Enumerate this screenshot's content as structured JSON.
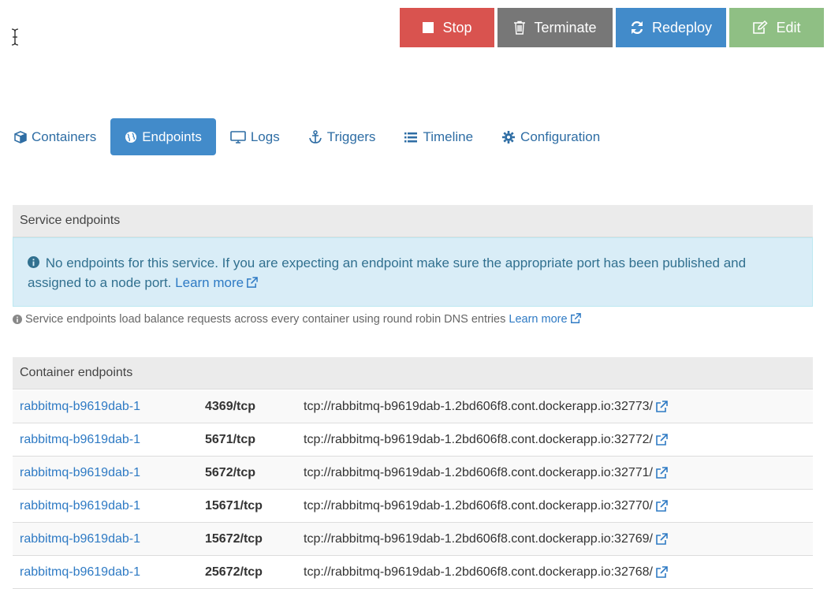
{
  "toolbar": {
    "stop_label": "Stop",
    "terminate_label": "Terminate",
    "redeploy_label": "Redeploy",
    "edit_label": "Edit"
  },
  "tabs": [
    {
      "label": "Containers",
      "icon": "cube-icon",
      "active": false
    },
    {
      "label": "Endpoints",
      "icon": "globe-icon",
      "active": true
    },
    {
      "label": "Logs",
      "icon": "desktop-icon",
      "active": false
    },
    {
      "label": "Triggers",
      "icon": "anchor-icon",
      "active": false
    },
    {
      "label": "Timeline",
      "icon": "list-icon",
      "active": false
    },
    {
      "label": "Configuration",
      "icon": "gear-icon",
      "active": false
    }
  ],
  "service_endpoints": {
    "title": "Service endpoints",
    "alert_text": "No endpoints for this service. If you are expecting an endpoint make sure the appropriate port has been published and assigned to a node port.",
    "alert_link": "Learn more",
    "help_text": "Service endpoints load balance requests across every container using round robin DNS entries",
    "help_link": "Learn more"
  },
  "container_endpoints": {
    "title": "Container endpoints",
    "rows": [
      {
        "container": "rabbitmq-b9619dab-1",
        "port": "4369/tcp",
        "url": "tcp://rabbitmq-b9619dab-1.2bd606f8.cont.dockerapp.io:32773/"
      },
      {
        "container": "rabbitmq-b9619dab-1",
        "port": "5671/tcp",
        "url": "tcp://rabbitmq-b9619dab-1.2bd606f8.cont.dockerapp.io:32772/"
      },
      {
        "container": "rabbitmq-b9619dab-1",
        "port": "5672/tcp",
        "url": "tcp://rabbitmq-b9619dab-1.2bd606f8.cont.dockerapp.io:32771/"
      },
      {
        "container": "rabbitmq-b9619dab-1",
        "port": "15671/tcp",
        "url": "tcp://rabbitmq-b9619dab-1.2bd606f8.cont.dockerapp.io:32770/"
      },
      {
        "container": "rabbitmq-b9619dab-1",
        "port": "15672/tcp",
        "url": "tcp://rabbitmq-b9619dab-1.2bd606f8.cont.dockerapp.io:32769/"
      },
      {
        "container": "rabbitmq-b9619dab-1",
        "port": "25672/tcp",
        "url": "tcp://rabbitmq-b9619dab-1.2bd606f8.cont.dockerapp.io:32768/"
      }
    ]
  },
  "colors": {
    "stop": "#d9534f",
    "terminate": "#777777",
    "redeploy": "#428bca",
    "edit": "#8fbf84",
    "link": "#2e7ac4",
    "alert_bg": "#d9edf7"
  }
}
